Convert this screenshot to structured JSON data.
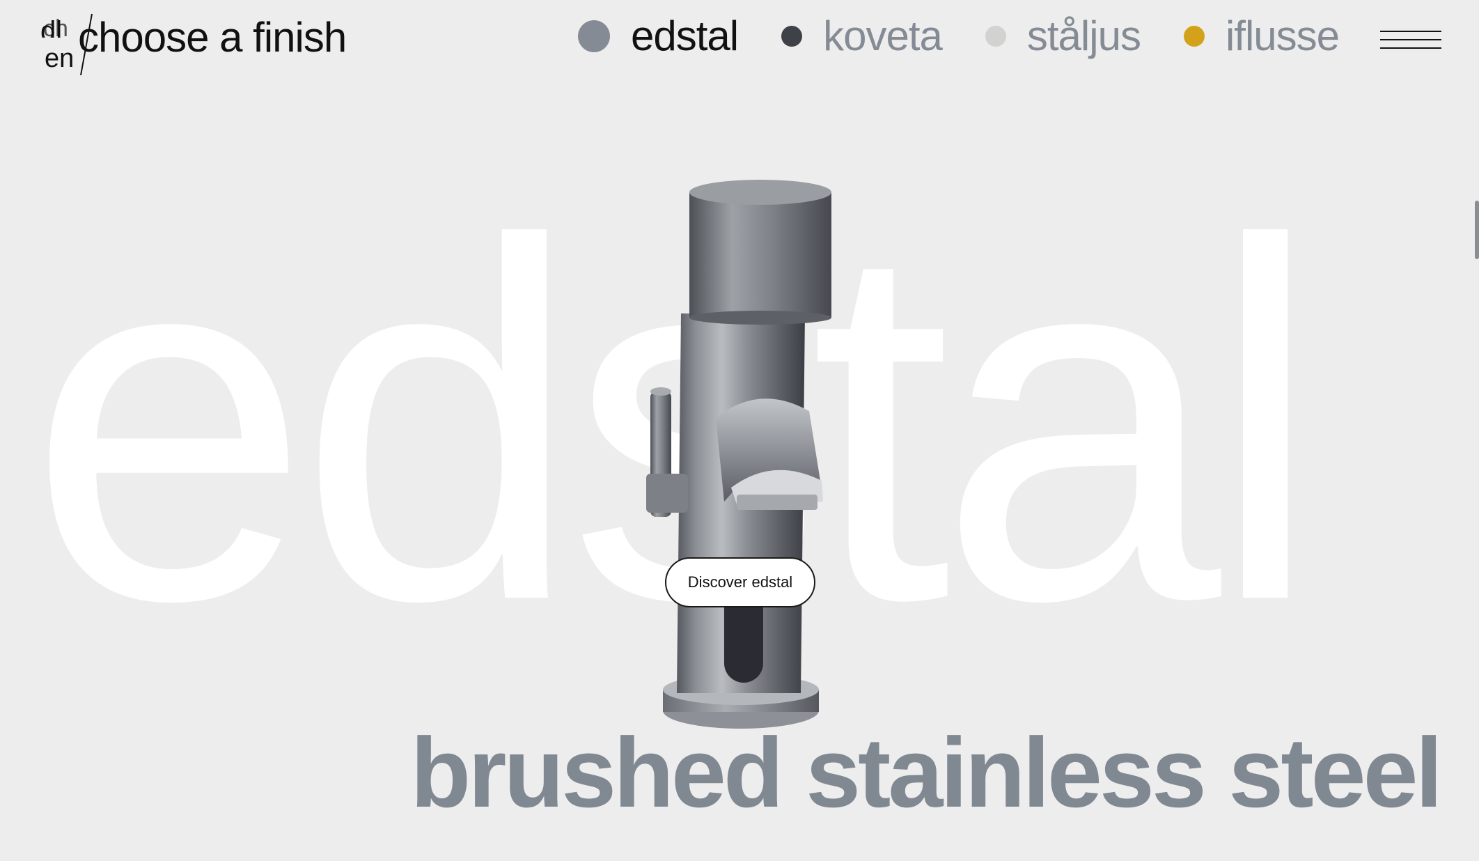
{
  "header": {
    "title": "choose a finish",
    "logo_icon": "glitch-logo-icon"
  },
  "finishes": [
    {
      "label": "edstal",
      "color": "#848b94",
      "active": true
    },
    {
      "label": "koveta",
      "color": "#3f4148",
      "active": false
    },
    {
      "label": "ståljus",
      "color": "#d2d2d0",
      "active": false
    },
    {
      "label": "iflusse",
      "color": "#d4a21a",
      "active": false
    }
  ],
  "menu": {
    "icon": "hamburger-menu-icon"
  },
  "hero": {
    "background_word": "edstal",
    "discover_label": "Discover edstal",
    "subtitle": "brushed stainless steel"
  },
  "colors": {
    "background": "#ededed",
    "subtitle": "#808892",
    "accent_gold": "#d4a21a"
  }
}
